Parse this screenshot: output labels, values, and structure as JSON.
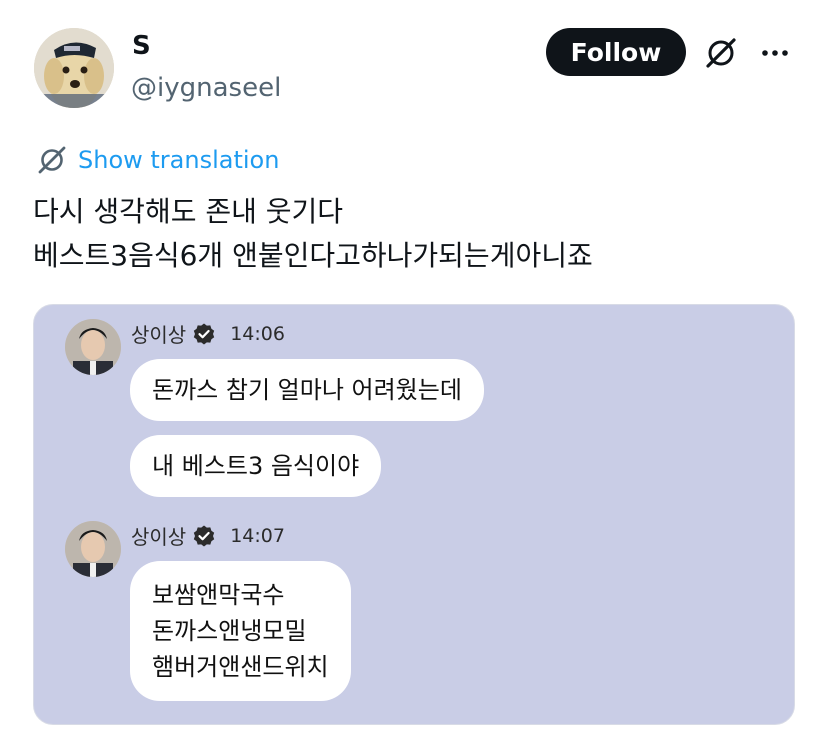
{
  "tweet": {
    "display_name": "S",
    "handle": "@iygnaseel",
    "follow_label": "Follow",
    "translation_label": "Show translation",
    "text_lines": [
      "다시 생각해도 존내 웃기다",
      "베스트3음식6개 앤붙인다고하나가되는게아니죠"
    ]
  },
  "chat": {
    "groups": [
      {
        "sender": "상이상",
        "time": "14:06",
        "messages": [
          "돈까스 참기 얼마나 어려웠는데",
          "내 베스트3 음식이야"
        ]
      },
      {
        "sender": "상이상",
        "time": "14:07",
        "messages": [
          "보쌈앤막국수",
          "돈까스앤냉모밀",
          "햄버거앤샌드위치"
        ]
      }
    ]
  },
  "colors": {
    "follow_bg": "#0f1419",
    "link": "#1d9bf0",
    "handle_gray": "#536471",
    "chat_bg": "#c9cde6",
    "bubble": "#ffffff"
  },
  "icons": [
    "grok-icon",
    "more-icon",
    "translate-icon",
    "verified-icon"
  ]
}
